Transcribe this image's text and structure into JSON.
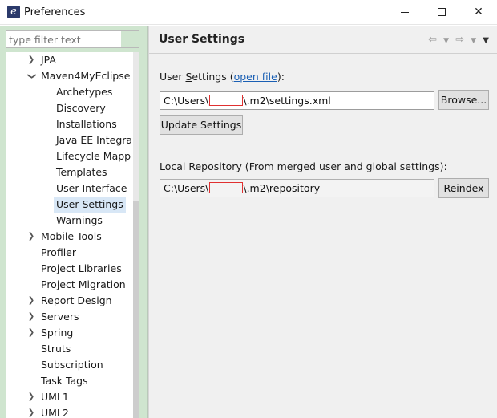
{
  "window": {
    "title": "Preferences",
    "icon": "eclipse-app-icon",
    "controls": [
      "minimize",
      "maximize",
      "close"
    ]
  },
  "sidebar": {
    "filter_placeholder": "type filter text",
    "items": [
      {
        "label": "JPA",
        "expander": "collapsed"
      },
      {
        "label": "Maven4MyEclipse",
        "expander": "expanded"
      },
      {
        "label": "Archetypes"
      },
      {
        "label": "Discovery"
      },
      {
        "label": "Installations"
      },
      {
        "label": "Java EE Integra"
      },
      {
        "label": "Lifecycle Mapp"
      },
      {
        "label": "Templates"
      },
      {
        "label": "User Interface"
      },
      {
        "label": "User Settings",
        "selected": true
      },
      {
        "label": "Warnings"
      },
      {
        "label": "Mobile Tools",
        "expander": "collapsed"
      },
      {
        "label": "Profiler"
      },
      {
        "label": "Project Libraries"
      },
      {
        "label": "Project Migration"
      },
      {
        "label": "Report Design",
        "expander": "collapsed"
      },
      {
        "label": "Servers",
        "expander": "collapsed"
      },
      {
        "label": "Spring",
        "expander": "collapsed"
      },
      {
        "label": "Struts"
      },
      {
        "label": "Subscription"
      },
      {
        "label": "Task Tags"
      },
      {
        "label": "UML1",
        "expander": "collapsed"
      },
      {
        "label": "UML2",
        "expander": "collapsed"
      }
    ]
  },
  "main": {
    "title": "User Settings",
    "user_settings_label_prefix": "User ",
    "user_settings_label_mnemonic": "S",
    "user_settings_label_suffix": "ettings (",
    "open_file_link": "open file",
    "user_settings_label_end": "):",
    "user_settings_path_start": "C:\\Users\\",
    "user_settings_path_end": "\\.m2\\settings.xml",
    "browse_button": "Browse...",
    "update_button": "Update Settings",
    "local_repo_label": "Local Repository (From merged user and global settings):",
    "local_repo_path_start": "C:\\Users\\",
    "local_repo_path_end": "\\.m2\\repository",
    "reindex_button": "Reindex"
  },
  "colors": {
    "sidebar_bg": "#cfe5cf",
    "selection_bg": "#d8e7f6",
    "link": "#1a5fb4",
    "redaction_box": "#e03030"
  }
}
